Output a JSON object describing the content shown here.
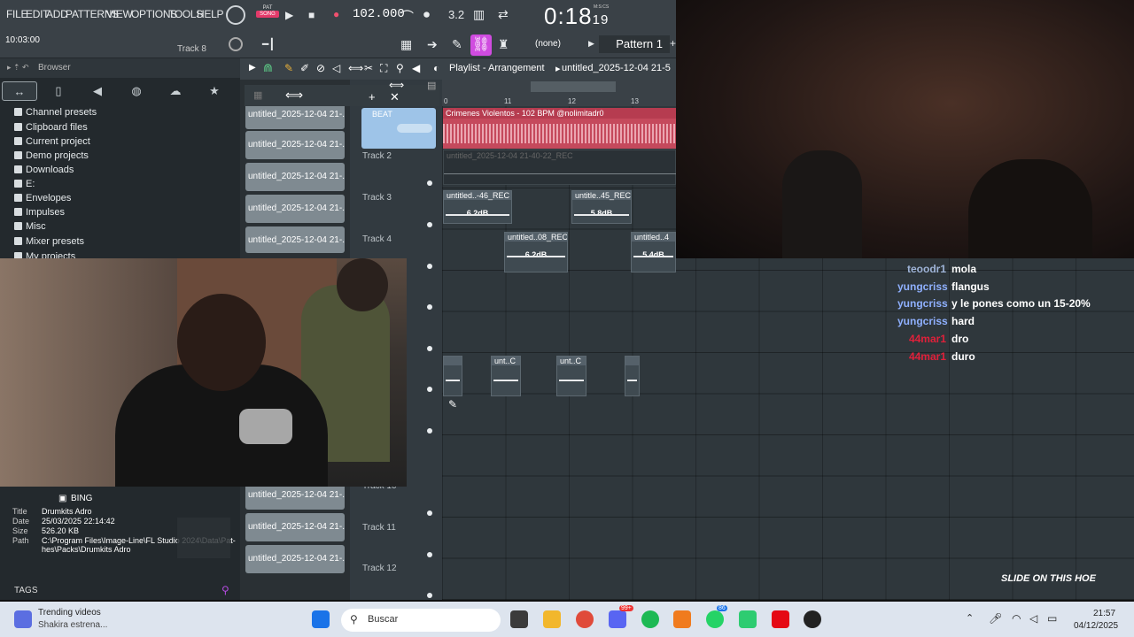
{
  "menu": [
    "FILE",
    "EDIT",
    "ADD",
    "PATTERNS",
    "VIEW",
    "OPTIONS",
    "TOOLS",
    "HELP"
  ],
  "transport": {
    "mode_label": "SONG",
    "mode_top": "PAT",
    "tempo": "102.000",
    "time_main": "0:18",
    "time_sub": "19",
    "time_unit": "M:S:CS"
  },
  "hint": {
    "left": "10:03:00",
    "right": "Track 8"
  },
  "snap": "(none)",
  "pattern_label": "Pattern 1",
  "browser": {
    "title": "Browser",
    "items": [
      "Channel presets",
      "Clipboard files",
      "Current project",
      "Demo projects",
      "Downloads",
      "E:",
      "Envelopes",
      "Impulses",
      "Misc",
      "Mixer presets",
      "My projects"
    ]
  },
  "playlist": {
    "title": "Playlist - Arrangement",
    "project": "untitled_2025-12-04 21-5",
    "ruler": [
      "0",
      "11",
      "12",
      "13"
    ],
    "beat_label": "BEAT",
    "main_clip": "Crimenes Violentos - 102 BPM @nolimitadr0",
    "rec_clip": "untitled_2025-12-04 21-40-22_REC",
    "tracks": [
      "Track 2",
      "Track 3",
      "Track 4",
      "Track 10",
      "Track 11",
      "Track 12"
    ],
    "clips": [
      {
        "label": "untitled..-46_REC",
        "db": "6.2dB"
      },
      {
        "label": "untitle..45_REC",
        "db": "5.8dB"
      },
      {
        "label": "untitled..08_REC",
        "db": "6.2dB"
      },
      {
        "label": "untitled..4",
        "db": "5.4dB"
      },
      {
        "label": "",
        "db": ""
      },
      {
        "label": "unt..C",
        "db": ""
      },
      {
        "label": "unt..C",
        "db": ""
      },
      {
        "label": "",
        "db": ""
      }
    ]
  },
  "patterns": [
    "untitled_2025-12-04 21-..",
    "untitled_2025-12-04 21-..",
    "untitled_2025-12-04 21-..",
    "untitled_2025-12-04 21-..",
    "untitled_2025-12-04 21-..",
    "untitled_2025-12-04 21-..",
    "untitled_2025-12-04 21-..",
    "untitled_2025-12-04 21-.."
  ],
  "info": {
    "name": "BING",
    "title_k": "Title",
    "title_v": "Drumkits Adro",
    "date_k": "Date",
    "date_v": "25/03/2025 22:14:42",
    "size_k": "Size",
    "size_v": "526.20 KB",
    "path_k": "Path",
    "path_v1": "C:\\Program Files\\Image-Line\\FL Studio 2024\\Data\\Pat-",
    "path_v2": "hes\\Packs\\Drumkits Adro",
    "tags": "TAGS"
  },
  "chat": [
    {
      "user": "teoodr1",
      "msg": "mola",
      "color": "#9fb4d8"
    },
    {
      "user": "yungcriss",
      "msg": "flangus",
      "color": "#8fb0ff"
    },
    {
      "user": "yungcriss",
      "msg": "y le pones como un 15-20%",
      "color": "#8fb0ff"
    },
    {
      "user": "yungcriss",
      "msg": "hard",
      "color": "#8fb0ff"
    },
    {
      "user": "44mar1",
      "msg": "dro",
      "color": "#e0203a"
    },
    {
      "user": "44mar1",
      "msg": "duro",
      "color": "#e0203a"
    }
  ],
  "overlay_logo": "SLIDE ON THIS HOE",
  "taskbar": {
    "widget_title": "Trending videos",
    "widget_sub": "Shakira estrena...",
    "search": "Buscar",
    "badge1": "99+",
    "badge2": "86",
    "time": "21:57",
    "date": "04/12/2025"
  }
}
